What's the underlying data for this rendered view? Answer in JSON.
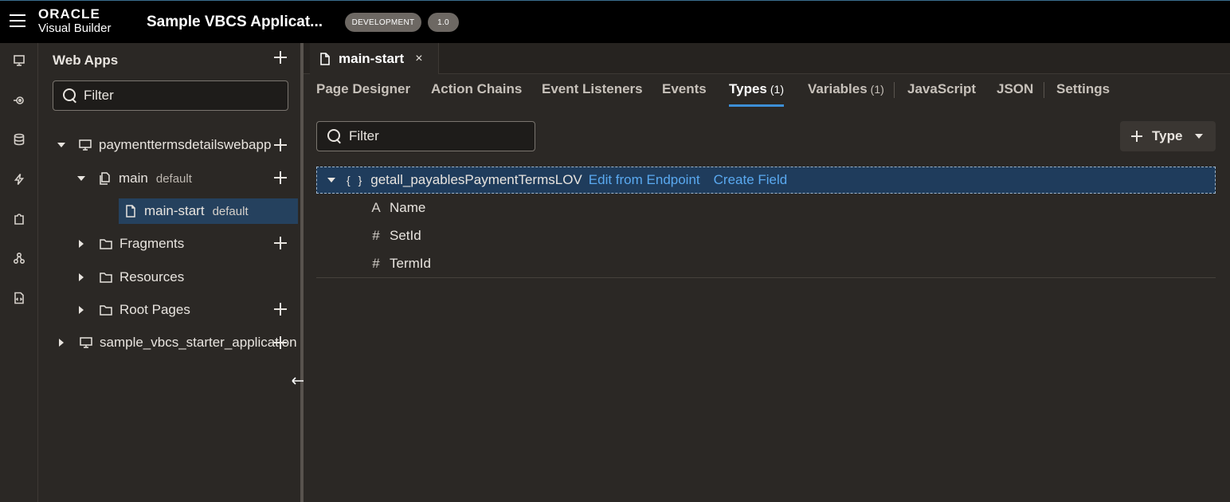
{
  "header": {
    "brand": "ORACLE",
    "product": "Visual Builder",
    "app_title": "Sample VBCS Applicat...",
    "env_badge": "DEVELOPMENT",
    "version_badge": "1.0"
  },
  "rail": {
    "icons": [
      "web-apps-icon",
      "services-icon",
      "business-objects-icon",
      "processes-icon",
      "components-icon",
      "mobile-apps-icon",
      "source-icon"
    ]
  },
  "panel": {
    "title": "Web Apps",
    "filter_placeholder": "Filter",
    "tree": {
      "app1": {
        "label": "paymenttermsdetailswebapp"
      },
      "main": {
        "label": "main",
        "sub": "default"
      },
      "main_start": {
        "label": "main-start",
        "sub": "default"
      },
      "fragments": {
        "label": "Fragments"
      },
      "resources": {
        "label": "Resources"
      },
      "root_pages": {
        "label": "Root Pages"
      },
      "app2": {
        "label": "sample_vbcs_starter_application"
      }
    }
  },
  "editor": {
    "tab_label": "main-start",
    "close_glyph": "×",
    "subtabs": {
      "page_designer": "Page Designer",
      "action_chains": "Action Chains",
      "event_listeners": "Event Listeners",
      "events": "Events",
      "types": "Types",
      "types_count": "(1)",
      "variables": "Variables",
      "variables_count": "(1)",
      "javascript": "JavaScript",
      "json": "JSON",
      "settings": "Settings"
    },
    "filter_placeholder": "Filter",
    "type_button": "Type",
    "type_entry": {
      "braces": "{ }",
      "name": "getall_payablesPaymentTermsLOV",
      "link_edit": "Edit from Endpoint",
      "link_create": "Create Field",
      "fields": [
        {
          "glyph": "A",
          "name": "Name"
        },
        {
          "glyph": "#",
          "name": "SetId"
        },
        {
          "glyph": "#",
          "name": "TermId"
        }
      ]
    }
  },
  "colors": {
    "accent": "#3d8fd6",
    "link": "#5aa9f0",
    "selected_row": "#25415e"
  }
}
